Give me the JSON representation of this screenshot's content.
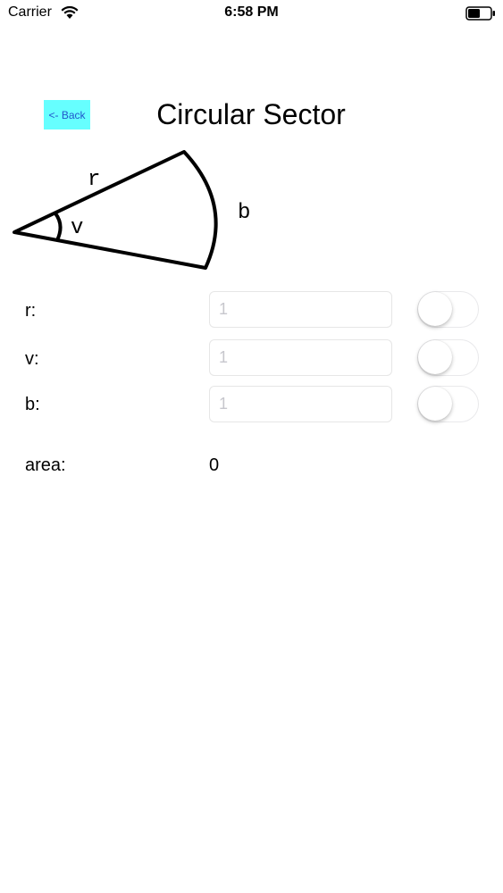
{
  "status_bar": {
    "carrier": "Carrier",
    "time": "6:58 PM"
  },
  "header": {
    "back_label": "<- Back",
    "title": "Circular Sector"
  },
  "diagram": {
    "radius_label": "r",
    "angle_label": "v",
    "arc_label": "b"
  },
  "form": {
    "r": {
      "label": "r:",
      "placeholder": "1",
      "value": "",
      "toggle_on": false
    },
    "v": {
      "label": "v:",
      "placeholder": "1",
      "value": "",
      "toggle_on": false
    },
    "b": {
      "label": "b:",
      "placeholder": "1",
      "value": "",
      "toggle_on": false
    }
  },
  "result": {
    "label": "area:",
    "value": "0"
  }
}
